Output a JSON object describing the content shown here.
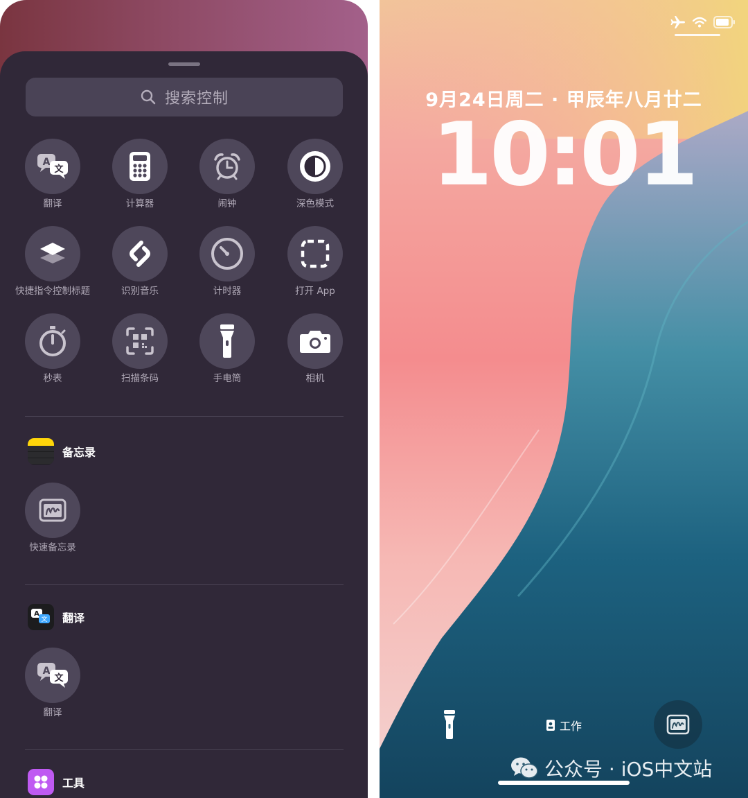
{
  "controls_panel": {
    "search": {
      "placeholder": "搜索控制",
      "icon": "search-icon"
    },
    "controls": [
      {
        "label": "翻译",
        "icon": "translate-icon"
      },
      {
        "label": "计算器",
        "icon": "calculator-icon"
      },
      {
        "label": "闹钟",
        "icon": "alarm-icon"
      },
      {
        "label": "深色模式",
        "icon": "dark-mode-icon"
      },
      {
        "label": "快捷指令控制标题",
        "icon": "shortcuts-icon"
      },
      {
        "label": "识别音乐",
        "icon": "shazam-icon"
      },
      {
        "label": "计时器",
        "icon": "timer-icon"
      },
      {
        "label": "打开 App",
        "icon": "open-app-icon"
      },
      {
        "label": "秒表",
        "icon": "stopwatch-icon"
      },
      {
        "label": "扫描条码",
        "icon": "qr-scan-icon"
      },
      {
        "label": "手电筒",
        "icon": "flashlight-icon"
      },
      {
        "label": "相机",
        "icon": "camera-icon"
      }
    ],
    "sections": [
      {
        "title": "备忘录",
        "icon": "notes-app-icon",
        "items": [
          {
            "label": "快速备忘录",
            "icon": "quick-note-icon"
          }
        ]
      },
      {
        "title": "翻译",
        "icon": "translate-app-icon",
        "items": [
          {
            "label": "翻译",
            "icon": "translate-icon"
          }
        ]
      },
      {
        "title": "工具",
        "icon": "tools-app-icon",
        "items": []
      }
    ]
  },
  "lock_screen": {
    "date": "9月24日周二 · 甲辰年八月廿二",
    "time": "10:01",
    "status_icons": [
      "airplane-icon",
      "wifi-icon",
      "battery-icon"
    ],
    "focus_label": "工作",
    "bottom_buttons": [
      "flashlight-icon",
      "quick-note-icon"
    ],
    "watermark": "公众号 · iOS中文站"
  },
  "colors": {
    "sheet_bg": "#302838",
    "control_bg": "#4e475a",
    "notes_yellow": "#ffd60a",
    "tools_purple": "#bf5af2"
  }
}
